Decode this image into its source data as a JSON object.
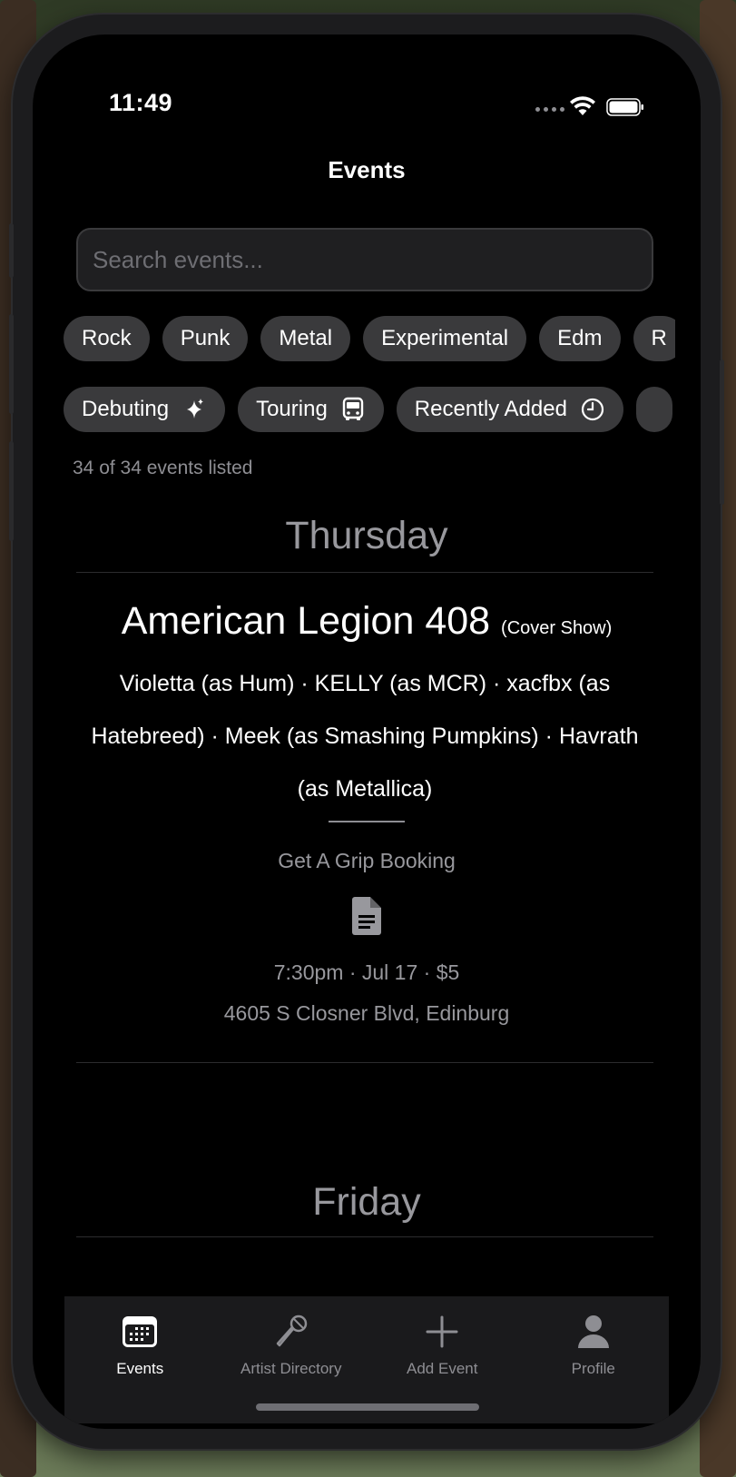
{
  "status_bar": {
    "time": "11:49"
  },
  "nav": {
    "title": "Events"
  },
  "search": {
    "placeholder": "Search events..."
  },
  "genres": [
    "Rock",
    "Punk",
    "Metal",
    "Experimental",
    "Edm",
    "R"
  ],
  "filters": [
    {
      "label": "Debuting",
      "icon": "sparkles-icon"
    },
    {
      "label": "Touring",
      "icon": "bus-icon"
    },
    {
      "label": "Recently Added",
      "icon": "clock-icon"
    }
  ],
  "events_count": "34 of 34 events listed",
  "days": [
    {
      "name": "Thursday",
      "events": [
        {
          "venue": "American Legion 408",
          "tag": "(Cover Show)",
          "lineup": "Violetta (as Hum) · KELLY (as MCR) · xacfbx (as Hatebreed) · Meek (as Smashing Pumpkins) · Havrath (as Metallica)",
          "promoter": "Get A Grip Booking",
          "icon": "document-icon",
          "time_date_price": "7:30pm · Jul 17 · $5",
          "address": "4605 S Closner Blvd, Edinburg"
        }
      ]
    },
    {
      "name": "Friday",
      "events": []
    }
  ],
  "tabs": [
    {
      "label": "Events",
      "icon": "calendar-icon",
      "active": true
    },
    {
      "label": "Artist Directory",
      "icon": "microphone-icon",
      "active": false
    },
    {
      "label": "Add Event",
      "icon": "plus-icon",
      "active": false
    },
    {
      "label": "Profile",
      "icon": "person-icon",
      "active": false
    }
  ],
  "colors": {
    "background": "#000000",
    "chip": "#3a3a3c",
    "secondary_text": "#98989d",
    "tabbar": "#1a1a1c"
  }
}
